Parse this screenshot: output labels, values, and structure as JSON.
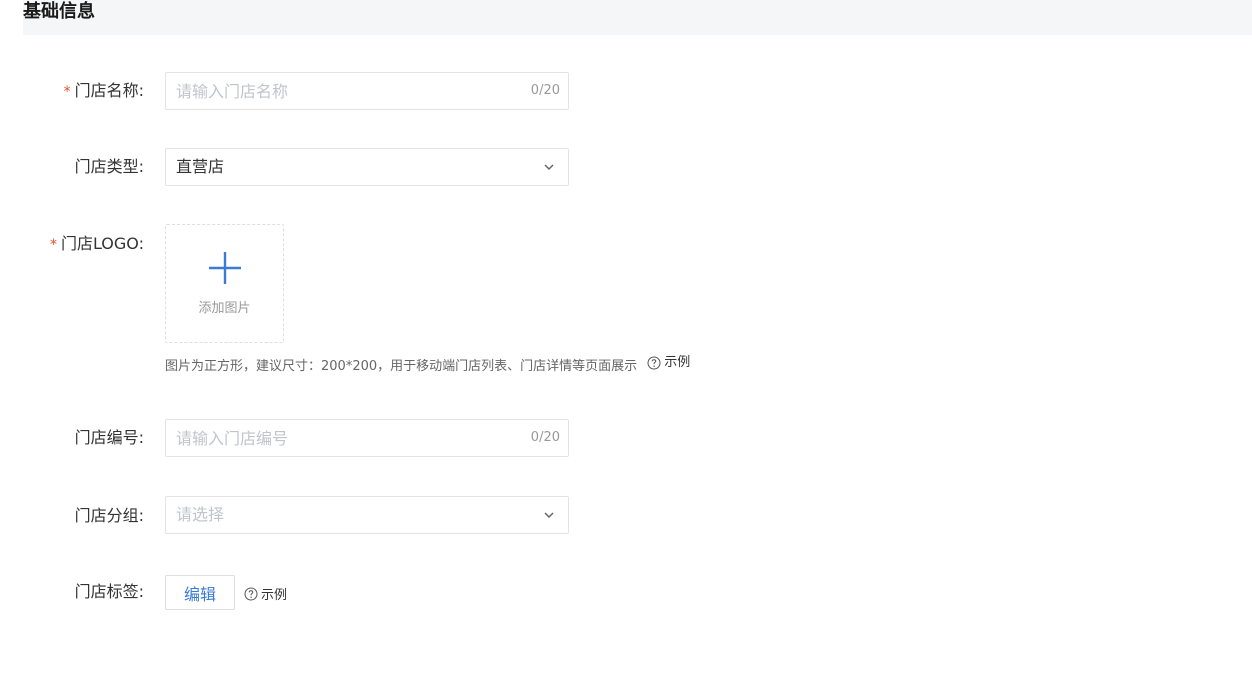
{
  "section": {
    "title": "基础信息"
  },
  "form": {
    "store_name": {
      "label": "门店名称:",
      "required_mark": "*",
      "placeholder": "请输入门店名称",
      "value": "",
      "counter": "0/20"
    },
    "store_type": {
      "label": "门店类型:",
      "selected": "直营店"
    },
    "store_logo": {
      "label": "门店LOGO:",
      "required_mark": "*",
      "upload_label": "添加图片",
      "hint": "图片为正方形，建议尺寸：200*200，用于移动端门店列表、门店详情等页面展示",
      "help_label": "示例"
    },
    "store_code": {
      "label": "门店编号:",
      "placeholder": "请输入门店编号",
      "value": "",
      "counter": "0/20"
    },
    "store_group": {
      "label": "门店分组:",
      "placeholder": "请选择"
    },
    "store_tags": {
      "label": "门店标签:",
      "edit_label": "编辑",
      "help_label": "示例"
    }
  },
  "colors": {
    "required": "#e34d26",
    "accent": "#3a7bd5",
    "header_bg": "#f5f6f7",
    "border": "#e1e3e6"
  },
  "icons": {
    "chevron": "chevron-down-icon",
    "plus": "plus-icon",
    "help": "question-circle-icon"
  }
}
